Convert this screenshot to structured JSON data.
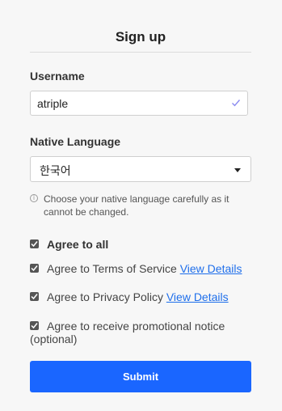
{
  "title": "Sign up",
  "username": {
    "label": "Username",
    "value": "atriple",
    "status_icon": "check-icon"
  },
  "language": {
    "label": "Native Language",
    "selected": "한국어",
    "hint": "Choose your native language carefully as it cannot be changed.",
    "hint_icon": "info-icon"
  },
  "agreements": {
    "all": {
      "label": "Agree to all",
      "checked": true
    },
    "terms": {
      "label": "Agree to Terms of Service ",
      "link": "View Details",
      "checked": true
    },
    "privacy": {
      "label": "Agree to Privacy Policy ",
      "link": "View Details",
      "checked": true
    },
    "promo": {
      "label": "Agree to receive promotional notice (optional)",
      "checked": true
    }
  },
  "submit_label": "Submit",
  "colors": {
    "accent": "#1a66ff",
    "link": "#1f6feb",
    "check": "#555555"
  }
}
